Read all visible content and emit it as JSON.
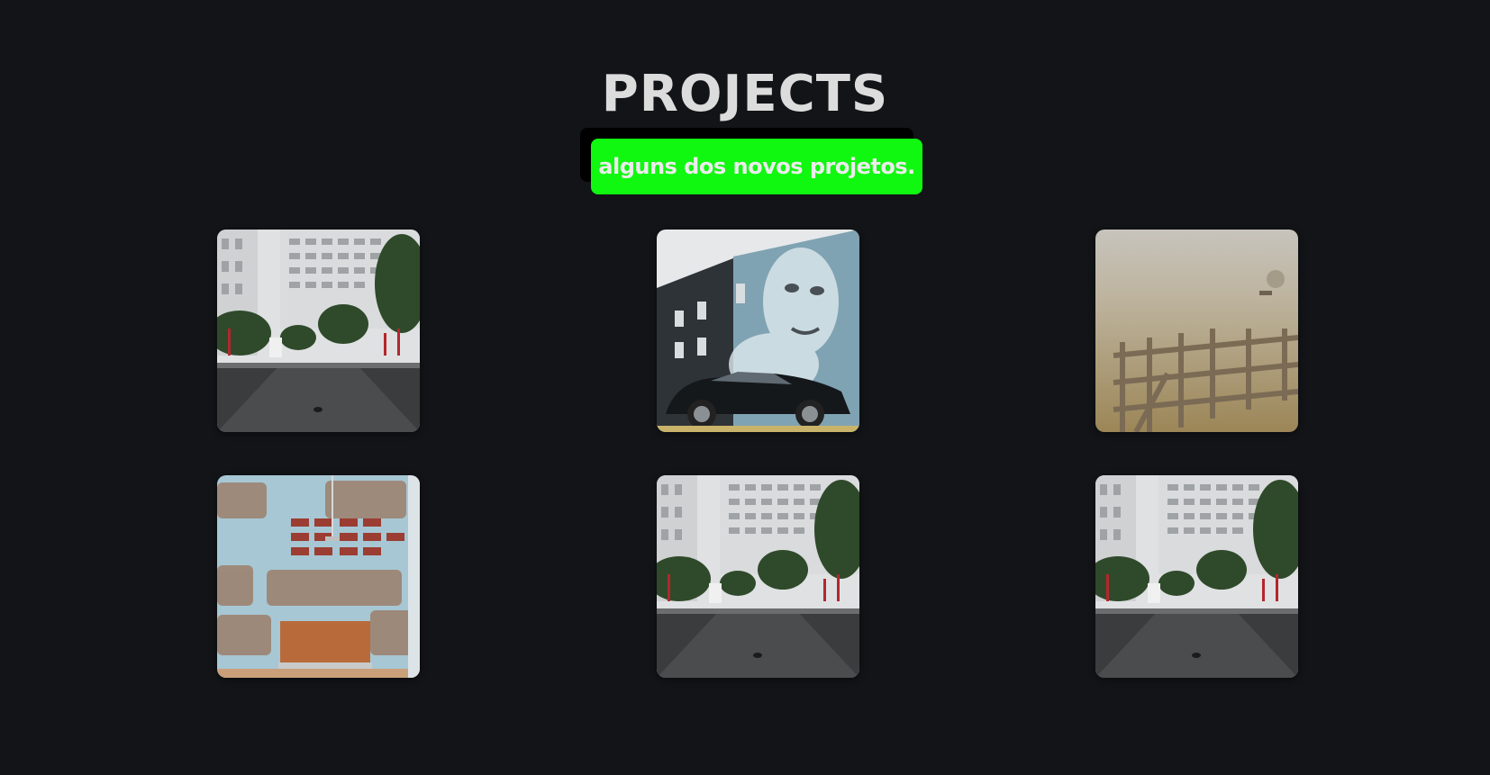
{
  "header": {
    "title": "PROJECTS",
    "subtitle": "alguns dos novos projetos."
  },
  "colors": {
    "background": "#121417",
    "title": "#dcdcdc",
    "subtitle_bg": "#10f810",
    "subtitle_shadow": "#000000",
    "subtitle_text": "#ececec"
  },
  "projects": [
    {
      "image": "campus-street"
    },
    {
      "image": "mural-car"
    },
    {
      "image": "foggy-fence"
    },
    {
      "image": "brick-wall-lamp"
    },
    {
      "image": "campus-street"
    },
    {
      "image": "campus-street"
    }
  ]
}
